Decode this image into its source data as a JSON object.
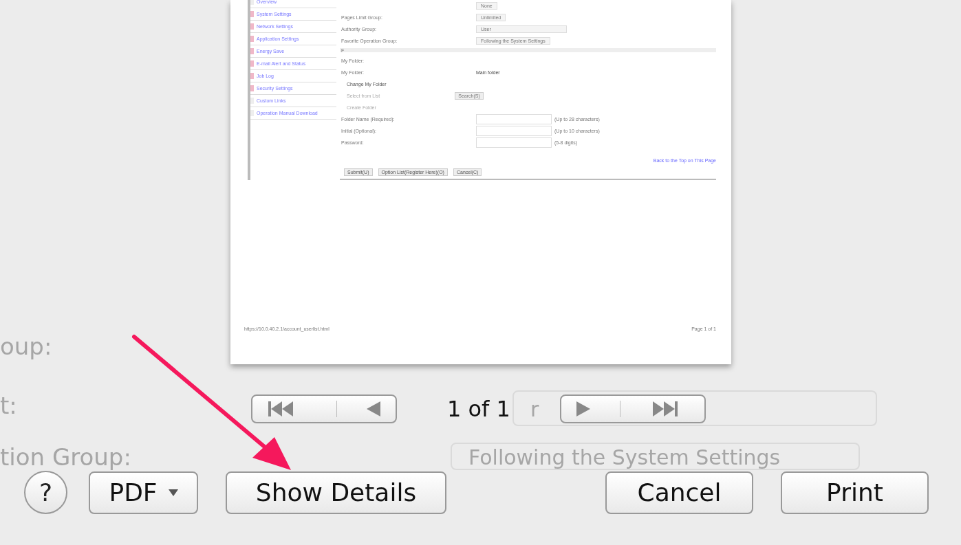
{
  "background_form": {
    "labels": [
      "oup:",
      "t:",
      "tion Group:"
    ],
    "fields": [
      {
        "value": "r"
      },
      {
        "value": "Following the System Settings"
      }
    ]
  },
  "preview": {
    "sidebar": {
      "items": [
        {
          "label": "Overview",
          "marked": false
        },
        {
          "label": "System Settings",
          "marked": true
        },
        {
          "label": "Network Settings",
          "marked": true
        },
        {
          "label": "Application Settings",
          "marked": true
        },
        {
          "label": "Energy Save",
          "marked": true
        },
        {
          "label": "E-mail Alert and Status",
          "marked": true
        },
        {
          "label": "Job Log",
          "marked": true
        },
        {
          "label": "Security Settings",
          "marked": true
        },
        {
          "label": "Custom Links",
          "marked": false
        },
        {
          "label": "Operation Manual Download",
          "marked": false
        }
      ]
    },
    "form": {
      "rows": [
        {
          "kind": "select",
          "label": "",
          "value": "None"
        },
        {
          "kind": "select",
          "label": "Pages Limit Group:",
          "value": "Unlimited"
        },
        {
          "kind": "wide-select",
          "label": "Authority Group:",
          "value": "User"
        },
        {
          "kind": "select",
          "label": "Favorite Operation Group:",
          "value": "Following the System Settings"
        },
        {
          "kind": "section",
          "label": "F"
        },
        {
          "kind": "text",
          "label": "My Folder:",
          "value": ""
        },
        {
          "kind": "text",
          "label": "My Folder:",
          "value": "Main folder"
        },
        {
          "kind": "radio",
          "label": "Change My Folder",
          "disabled": false,
          "value": ""
        },
        {
          "kind": "radio",
          "label": "Select from List",
          "disabled": true,
          "value": "Search(S)"
        },
        {
          "kind": "radio",
          "label": "Create Folder",
          "disabled": true,
          "value": ""
        },
        {
          "kind": "input",
          "label": "Folder Name (Required):",
          "hint": "(Up to 28 characters)"
        },
        {
          "kind": "input",
          "label": "Initial (Optional):",
          "hint": "(Up to 10 characters)"
        },
        {
          "kind": "input",
          "label": "Password:",
          "hint": "(5-8 digits)"
        }
      ]
    },
    "top_link": "Back to the Top on This Page",
    "buttons": [
      "Submit(U)",
      "Option List(Register Here)(O)",
      "Cancel(C)"
    ],
    "footer_url": "https://10.0.40.2.1/account_userlist.html",
    "footer_page": "Page 1 of 1"
  },
  "pager": {
    "page": "1 of 1"
  },
  "help_label": "?",
  "pdf_label": "PDF",
  "buttons": [
    {
      "kind": "details",
      "label": "Show Details"
    },
    {
      "kind": "cancel",
      "label": "Cancel"
    },
    {
      "kind": "print",
      "label": "Print"
    }
  ]
}
